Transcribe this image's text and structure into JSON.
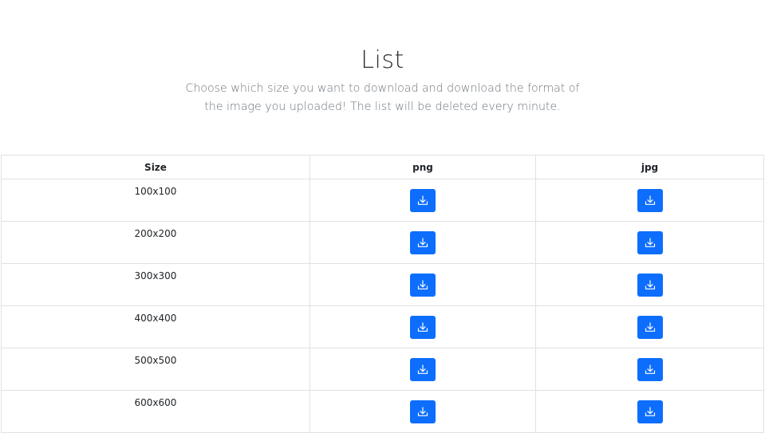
{
  "header": {
    "title": "List",
    "subtitle": "Choose which size you want to download and download the format of the image you uploaded! The list will be deleted every minute."
  },
  "table": {
    "columns": [
      "Size",
      "png",
      "jpg"
    ],
    "rows": [
      {
        "size": "100x100"
      },
      {
        "size": "200x200"
      },
      {
        "size": "300x300"
      },
      {
        "size": "400x400"
      },
      {
        "size": "500x500"
      },
      {
        "size": "600x600"
      }
    ]
  },
  "icons": {
    "download": "download-icon"
  },
  "colors": {
    "button": "#0d6efd",
    "border": "#dee2e6",
    "subtitle": "#6c757d"
  }
}
